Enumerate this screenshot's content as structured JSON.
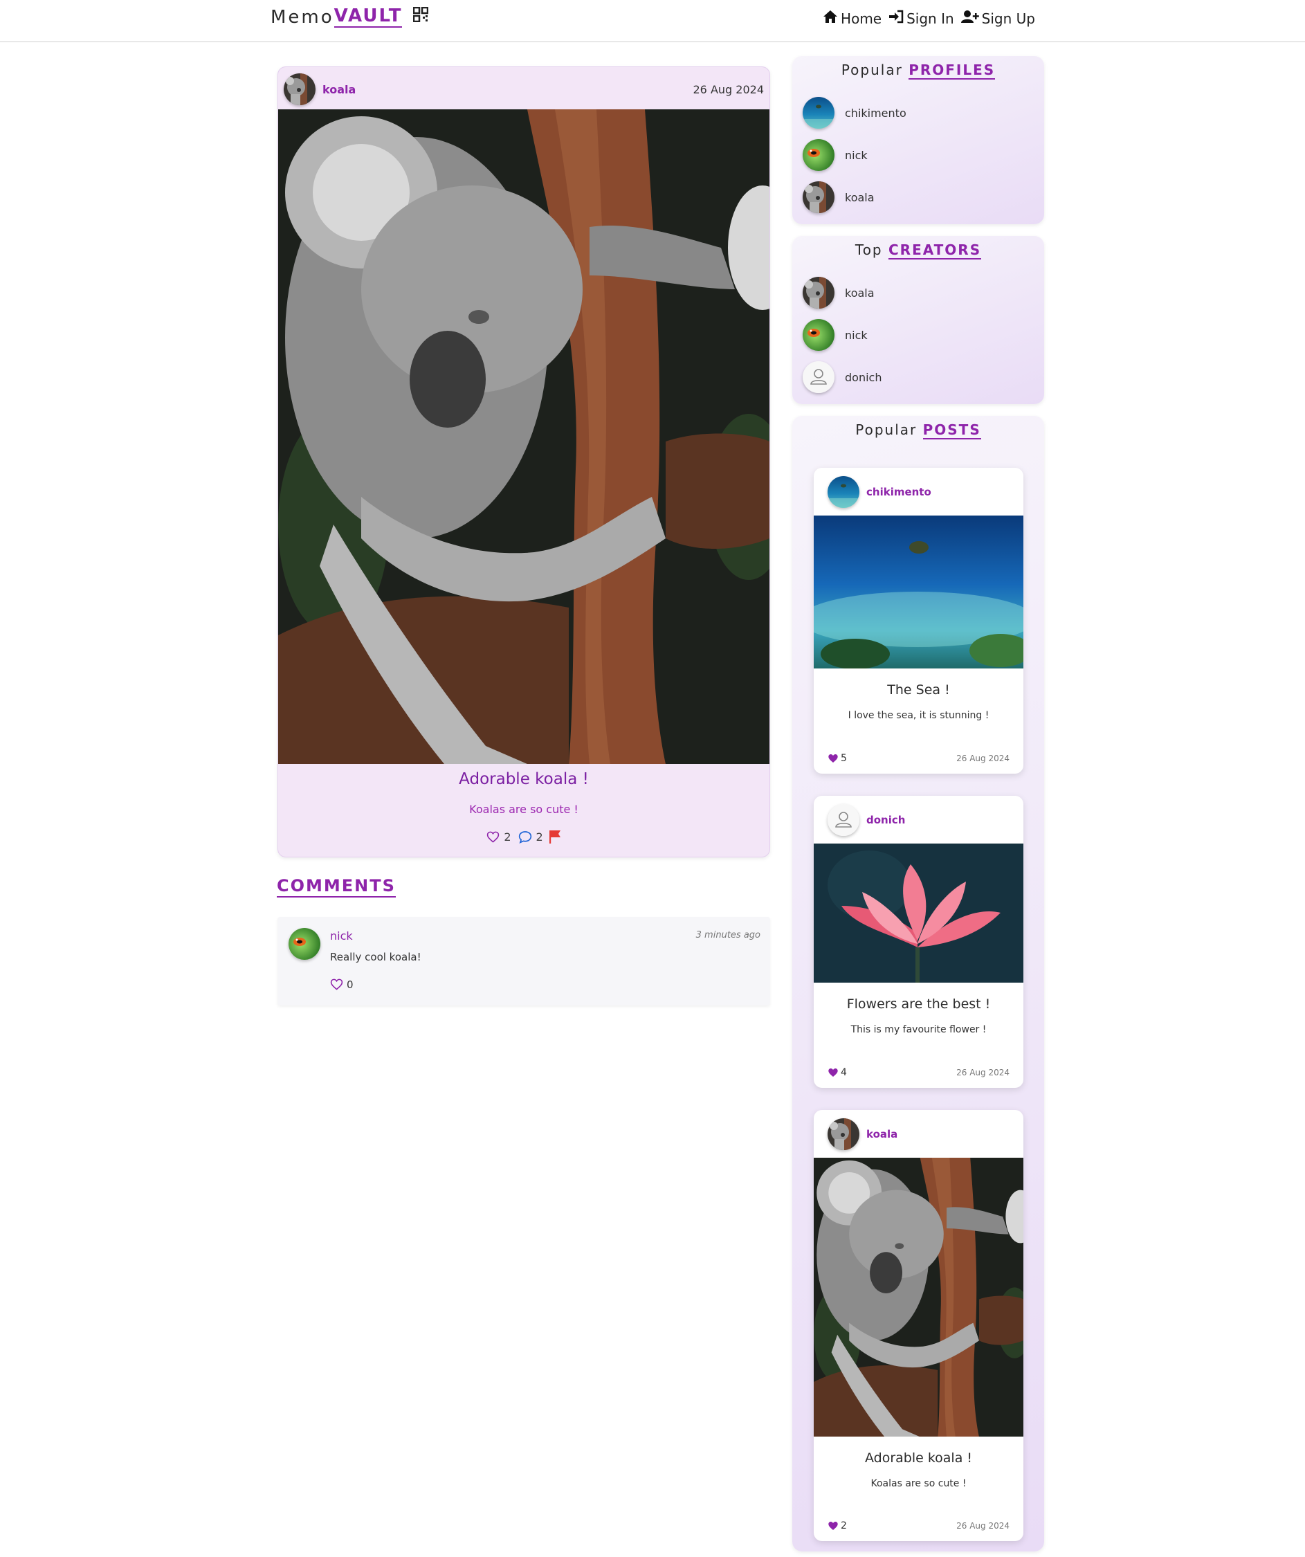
{
  "brand": {
    "memo": "Memo",
    "vault": "VAULT",
    "icon": "qr-code-icon"
  },
  "nav": [
    {
      "label": "Home",
      "icon": "house-icon"
    },
    {
      "label": "Sign In",
      "icon": "sign-in-icon"
    },
    {
      "label": "Sign Up",
      "icon": "user-plus-icon"
    }
  ],
  "post": {
    "user": "koala",
    "date": "26 Aug 2024",
    "title": "Adorable koala !",
    "description": "Koalas are so cute !",
    "likes": "2",
    "comments": "2"
  },
  "comments": {
    "title": "COMMENTS",
    "items": [
      {
        "user": "nick",
        "time": "3 minutes ago",
        "text": "Really cool koala!",
        "likes": "0"
      }
    ]
  },
  "popular_profiles": {
    "title_plain": "Popular",
    "title_highlight": "PROFILES",
    "items": [
      "chikimento",
      "nick",
      "koala"
    ]
  },
  "top_creators": {
    "title_plain": "Top",
    "title_highlight": "CREATORS",
    "items": [
      "koala",
      "nick",
      "donich"
    ]
  },
  "popular_posts": {
    "title_plain": "Popular",
    "title_highlight": "POSTS",
    "items": [
      {
        "user": "chikimento",
        "title": "The Sea !",
        "description": "I love the sea, it is stunning !",
        "likes": "5",
        "date": "26 Aug 2024"
      },
      {
        "user": "donich",
        "title": "Flowers are the best !",
        "description": "This is my favourite flower !",
        "likes": "4",
        "date": "26 Aug 2024"
      },
      {
        "user": "koala",
        "title": "Adorable koala !",
        "description": "Koalas are so cute !",
        "likes": "2",
        "date": "26 Aug 2024"
      }
    ]
  },
  "colors": {
    "accent": "#8e24aa",
    "post_bg": "#f3e6f7",
    "flag": "#e53935",
    "comment_icon": "#1e63d6"
  }
}
